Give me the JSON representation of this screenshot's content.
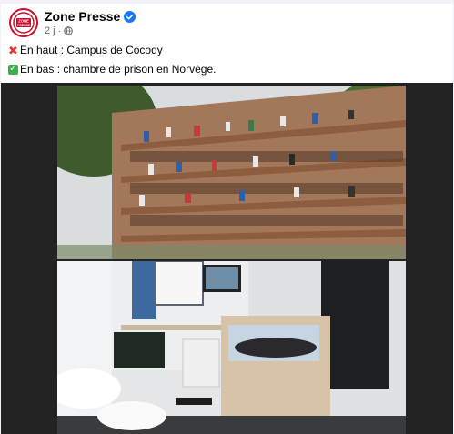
{
  "post": {
    "page_name": "Zone Presse",
    "time": "2 j",
    "separator": "·",
    "avatar_text": "ZONE PRESSE",
    "lines": [
      {
        "icon": "red-cross-icon",
        "text": "En haut : Campus de Cocody"
      },
      {
        "icon": "green-check-icon",
        "text": "En bas : chambre de prison en Norvège."
      }
    ]
  },
  "colors": {
    "brand": "#c8102e",
    "verified": "#1877f2",
    "meta_text": "#65676b",
    "red_cross": "#e53935",
    "green_check": "#3cb04a",
    "media_background": "#232323"
  },
  "icons": {
    "verified": "verified-badge-icon",
    "audience": "globe-icon"
  }
}
